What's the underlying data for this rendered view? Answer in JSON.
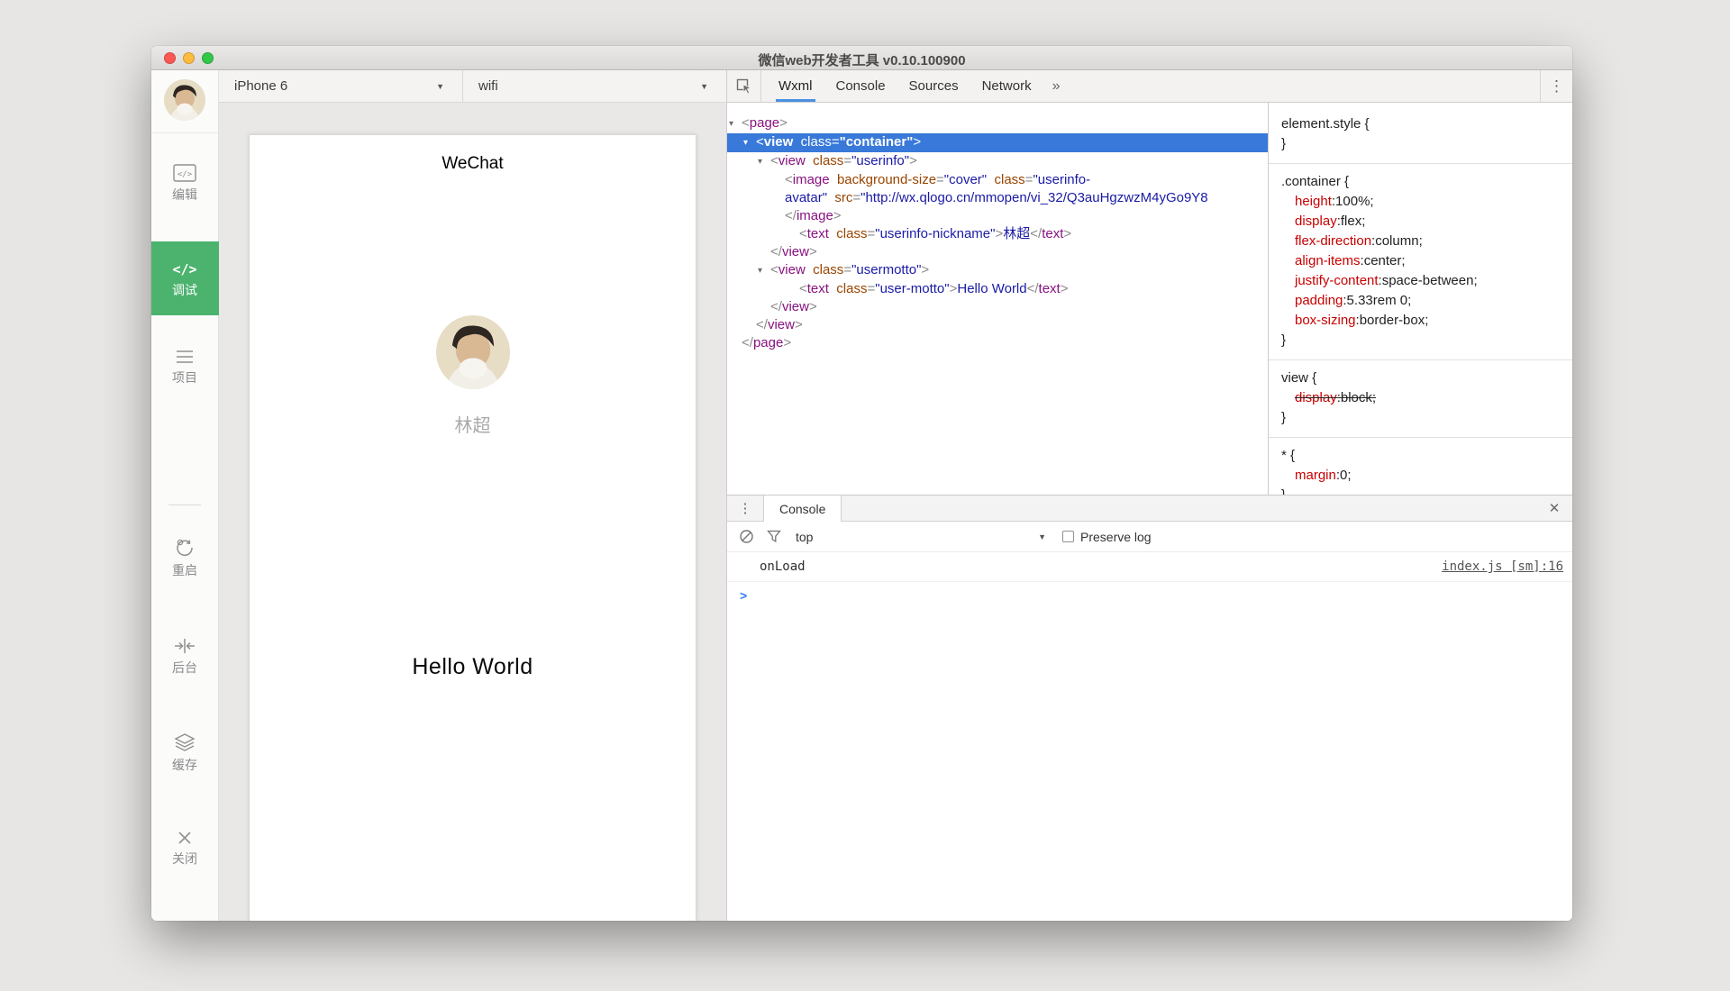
{
  "window": {
    "title": "微信web开发者工具 v0.10.100900"
  },
  "sidebar": {
    "items": [
      {
        "id": "edit",
        "label": "编辑",
        "icon": "code-box-icon",
        "active": false
      },
      {
        "id": "debug",
        "label": "调试",
        "icon": "code-icon",
        "active": true
      },
      {
        "id": "project",
        "label": "项目",
        "icon": "menu-icon",
        "active": false
      },
      {
        "id": "restart",
        "label": "重启",
        "icon": "restart-icon",
        "active": false,
        "divider_before": true
      },
      {
        "id": "background",
        "label": "后台",
        "icon": "deploy-icon",
        "active": false
      },
      {
        "id": "cache",
        "label": "缓存",
        "icon": "layers-icon",
        "active": false
      },
      {
        "id": "close",
        "label": "关闭",
        "icon": "close-icon",
        "active": false
      }
    ]
  },
  "device_toolbar": {
    "device": "iPhone 6",
    "network": "wifi"
  },
  "phone": {
    "nav_title": "WeChat",
    "nickname": "林超",
    "motto": "Hello World"
  },
  "devtools": {
    "tabs": [
      {
        "label": "Wxml",
        "active": true
      },
      {
        "label": "Console",
        "active": false
      },
      {
        "label": "Sources",
        "active": false
      },
      {
        "label": "Network",
        "active": false
      }
    ],
    "overflow_label": "»",
    "accent_colors": {
      "tab_underline": "#4a90e2",
      "selected_row": "#3879d9",
      "sidebar_active": "#4cb36e"
    },
    "tree": {
      "lines": [
        {
          "indent": 0,
          "arrow": true,
          "selected": false,
          "tokens": [
            [
              "p",
              "<"
            ],
            [
              "tag",
              "page"
            ],
            [
              "p",
              ">"
            ]
          ]
        },
        {
          "indent": 1,
          "arrow": true,
          "selected": true,
          "tokens": [
            [
              "p",
              "<"
            ],
            [
              "tag",
              "view"
            ],
            [
              "p",
              "  "
            ],
            [
              "attr",
              "class"
            ],
            [
              "p",
              "="
            ],
            [
              "val",
              "\"container\""
            ],
            [
              "p",
              ">"
            ]
          ]
        },
        {
          "indent": 2,
          "arrow": true,
          "selected": false,
          "tokens": [
            [
              "p",
              "<"
            ],
            [
              "tag",
              "view"
            ],
            [
              "p",
              "  "
            ],
            [
              "attr",
              "class"
            ],
            [
              "p",
              "="
            ],
            [
              "val",
              "\"userinfo\""
            ],
            [
              "p",
              ">"
            ]
          ]
        },
        {
          "indent": 3,
          "arrow": false,
          "selected": false,
          "tokens": [
            [
              "p",
              "<"
            ],
            [
              "tag",
              "image"
            ],
            [
              "p",
              "  "
            ],
            [
              "attr",
              "background-size"
            ],
            [
              "p",
              "="
            ],
            [
              "val",
              "\"cover\""
            ],
            [
              "p",
              "  "
            ],
            [
              "attr",
              "class"
            ],
            [
              "p",
              "="
            ],
            [
              "val",
              "\"userinfo-"
            ]
          ]
        },
        {
          "indent": 3,
          "arrow": false,
          "selected": false,
          "tokens": [
            [
              "val",
              "avatar\""
            ],
            [
              "p",
              "  "
            ],
            [
              "attr",
              "src"
            ],
            [
              "p",
              "="
            ],
            [
              "val",
              "\"http://wx.qlogo.cn/mmopen/vi_32/Q3auHgzwzM4yGo9Y8"
            ]
          ]
        },
        {
          "indent": 3,
          "arrow": false,
          "selected": false,
          "tokens": [
            [
              "p",
              "</"
            ],
            [
              "tag",
              "image"
            ],
            [
              "p",
              ">"
            ]
          ]
        },
        {
          "indent": 4,
          "arrow": false,
          "selected": false,
          "tokens": [
            [
              "p",
              "<"
            ],
            [
              "tag",
              "text"
            ],
            [
              "p",
              "  "
            ],
            [
              "attr",
              "class"
            ],
            [
              "p",
              "="
            ],
            [
              "val",
              "\"userinfo-nickname\""
            ],
            [
              "p",
              ">"
            ],
            [
              "txt",
              "林超"
            ],
            [
              "p",
              "</"
            ],
            [
              "tag",
              "text"
            ],
            [
              "p",
              ">"
            ]
          ]
        },
        {
          "indent": 2,
          "arrow": false,
          "selected": false,
          "tokens": [
            [
              "p",
              "</"
            ],
            [
              "tag",
              "view"
            ],
            [
              "p",
              ">"
            ]
          ]
        },
        {
          "indent": 2,
          "arrow": true,
          "selected": false,
          "tokens": [
            [
              "p",
              "<"
            ],
            [
              "tag",
              "view"
            ],
            [
              "p",
              "  "
            ],
            [
              "attr",
              "class"
            ],
            [
              "p",
              "="
            ],
            [
              "val",
              "\"usermotto\""
            ],
            [
              "p",
              ">"
            ]
          ]
        },
        {
          "indent": 4,
          "arrow": false,
          "selected": false,
          "tokens": [
            [
              "p",
              "<"
            ],
            [
              "tag",
              "text"
            ],
            [
              "p",
              "  "
            ],
            [
              "attr",
              "class"
            ],
            [
              "p",
              "="
            ],
            [
              "val",
              "\"user-motto\""
            ],
            [
              "p",
              ">"
            ],
            [
              "txt",
              "Hello World"
            ],
            [
              "p",
              "</"
            ],
            [
              "tag",
              "text"
            ],
            [
              "p",
              ">"
            ]
          ]
        },
        {
          "indent": 2,
          "arrow": false,
          "selected": false,
          "tokens": [
            [
              "p",
              "</"
            ],
            [
              "tag",
              "view"
            ],
            [
              "p",
              ">"
            ]
          ]
        },
        {
          "indent": 1,
          "arrow": false,
          "selected": false,
          "tokens": [
            [
              "p",
              "</"
            ],
            [
              "tag",
              "view"
            ],
            [
              "p",
              ">"
            ]
          ]
        },
        {
          "indent": 0,
          "arrow": false,
          "selected": false,
          "tokens": [
            [
              "p",
              "</"
            ],
            [
              "tag",
              "page"
            ],
            [
              "p",
              ">"
            ]
          ]
        }
      ]
    },
    "styles": {
      "rules": [
        {
          "selector": "element.style",
          "props": []
        },
        {
          "selector": ".container",
          "props": [
            [
              "height",
              "100%"
            ],
            [
              "display",
              "flex"
            ],
            [
              "flex-direction",
              "column"
            ],
            [
              "align-items",
              "center"
            ],
            [
              "justify-content",
              "space-between"
            ],
            [
              "padding",
              "5.33rem 0"
            ],
            [
              "box-sizing",
              "border-box"
            ]
          ]
        },
        {
          "selector": "view",
          "struck": true,
          "props": [
            [
              "display",
              "block"
            ]
          ]
        },
        {
          "selector": "*",
          "props": [
            [
              "margin",
              "0"
            ]
          ]
        }
      ]
    },
    "console": {
      "tab_label": "Console",
      "context": "top",
      "preserve_label": "Preserve log",
      "log": {
        "message": "onLoad",
        "source": "index.js [sm]:16"
      },
      "prompt": ">"
    }
  }
}
